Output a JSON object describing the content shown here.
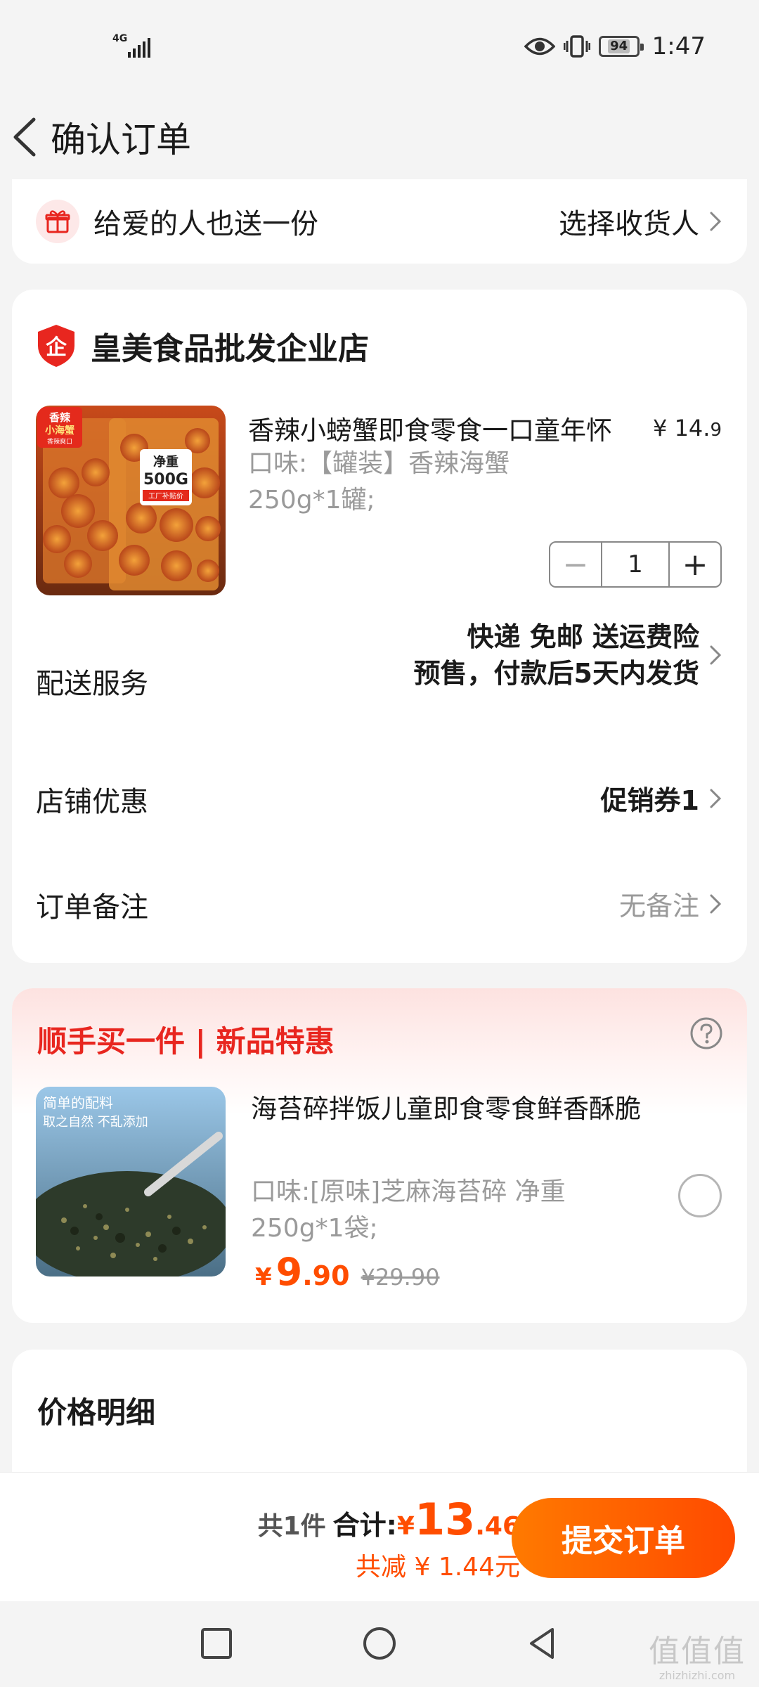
{
  "status_bar": {
    "network": "4G",
    "battery": "94",
    "time": "1:47"
  },
  "header": {
    "title": "确认订单"
  },
  "gift": {
    "text": "给爱的人也送一份",
    "action": "选择收货人"
  },
  "shop": {
    "name": "皇美食品批发企业店"
  },
  "product": {
    "title": "香辣小螃蟹即食零食一口童年怀",
    "price_symbol": "¥",
    "price_int": "14.",
    "price_dec": "9",
    "spec": "口味:【罐装】香辣海蟹250g*1罐;",
    "quantity": "1",
    "image_text": {
      "badge_line1": "香辣",
      "badge_line2": "小海蟹",
      "badge_sub": "香辣爽口",
      "weight_label": "净重",
      "weight_value": "500G",
      "weight_sub": "工厂补贴价"
    }
  },
  "delivery": {
    "label": "配送服务",
    "line1": "快递 免邮 送运费险",
    "line2": "预售，付款后5天内发货"
  },
  "discount": {
    "label": "店铺优惠",
    "value": "促销券1"
  },
  "note": {
    "label": "订单备注",
    "value": "无备注"
  },
  "addon": {
    "title": "顺手买一件 | 新品特惠",
    "product_title": "海苔碎拌饭儿童即食零食鲜香酥脆",
    "spec": "口味:[原味]芝麻海苔碎 净重250g*1袋;",
    "price_symbol": "¥",
    "price_int": "9",
    "price_dec": ".90",
    "original_price": "¥29.90",
    "image_text": {
      "line1": "简单的配料",
      "line2": "取之自然 不乱添加"
    }
  },
  "price_detail": {
    "title": "价格明细"
  },
  "footer": {
    "count": "共1件",
    "total_label": "合计:",
    "total_symbol": "¥",
    "total_int": "13",
    "total_dec": ".46",
    "saved": "共减 ¥ 1.44元",
    "submit": "提交订单"
  },
  "watermark": {
    "glyphs": "值值值",
    "url": "zhizhizhi.com"
  },
  "colors": {
    "accent_orange": "#ff4d00",
    "promo_red": "#e8261f",
    "shop_shield": "#e8261f"
  }
}
